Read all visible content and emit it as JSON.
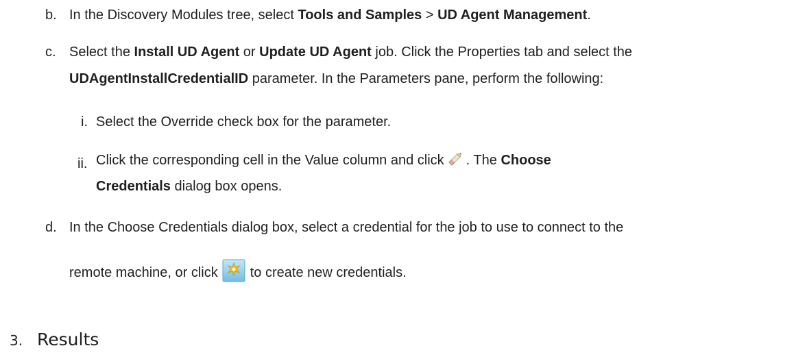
{
  "steps": {
    "b": {
      "marker": "b.",
      "text1": "In the Discovery Modules tree, select ",
      "bold1": "Tools and Samples",
      "text2": " > ",
      "bold2": "UD Agent Management",
      "text3": "."
    },
    "c": {
      "marker": "c.",
      "line1_text1": "Select the ",
      "line1_bold1": "Install UD Agent",
      "line1_text2": " or ",
      "line1_bold2": "Update UD Agent",
      "line1_text3": " job. Click the Properties tab and select the",
      "line2_bold1": "UDAgentInstallCredentialID",
      "line2_text1": " parameter. In the Parameters pane, perform the following:"
    },
    "c_i": {
      "marker": "i.",
      "text": "Select the Override check box for the parameter."
    },
    "c_ii": {
      "marker": "ii.",
      "line1_text1": "Click the corresponding cell in the Value column and click",
      "line1_text2": ". The ",
      "line1_bold1": "Choose",
      "line2_bold1": "Credentials",
      "line2_text1": " dialog box opens."
    },
    "d": {
      "marker": "d.",
      "line1_text": "In the Choose Credentials dialog box, select a credential for the job to use to connect to the",
      "line2_text1": "remote machine, or click",
      "line2_text2": "to create new credentials."
    },
    "section": {
      "number": "3.",
      "title": "Results"
    },
    "icons": {
      "edit": "pencil-icon",
      "new_credential": "new-credential-icon"
    },
    "colors": {
      "text": "#1f1f1f",
      "new_credential_bg": "#8fd0ee",
      "new_credential_star": "#f2c318"
    }
  }
}
